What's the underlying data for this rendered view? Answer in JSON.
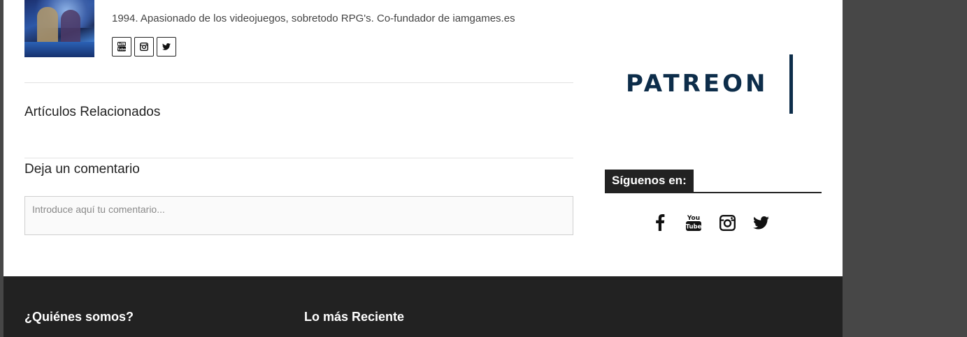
{
  "author": {
    "bio": "1994. Apasionado de los videojuegos, sobretodo RPG's. Co-fundador de iamgames.es",
    "social": [
      {
        "icon": "youtube-icon",
        "label": "YouTube"
      },
      {
        "icon": "instagram-icon",
        "label": "Instagram"
      },
      {
        "icon": "twitter-icon",
        "label": "Twitter"
      }
    ]
  },
  "main": {
    "related_title": "Artículos Relacionados",
    "comment_title": "Deja un comentario",
    "comment_placeholder": "Introduce aquí tu comentario..."
  },
  "sidebar": {
    "patreon_text": "PATREON",
    "patreon_color": "#0d2d4a",
    "follow_title": "Síguenos en:",
    "follow_icons": [
      "facebook-icon",
      "youtube-icon",
      "instagram-icon",
      "twitter-icon"
    ]
  },
  "footer": {
    "about_title": "¿Quiénes somos?",
    "recent_title": "Lo más Reciente"
  },
  "colors": {
    "background": "#474747",
    "footer": "#222222",
    "text": "#222222"
  }
}
